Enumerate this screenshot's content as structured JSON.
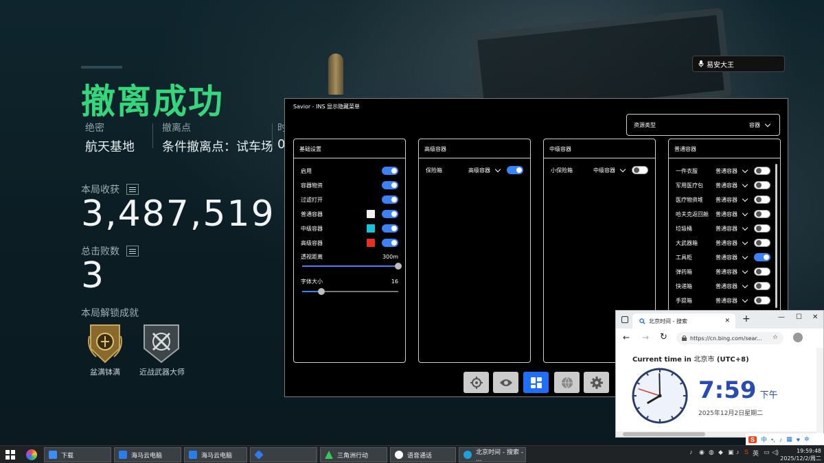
{
  "overlay": {
    "title": "撤离成功",
    "info": [
      {
        "label": "绝密",
        "value": "航天基地"
      },
      {
        "label": "撤离点",
        "value": "条件撤离点：试车场"
      },
      {
        "label": "时",
        "value": "0"
      }
    ],
    "stats": [
      {
        "label": "本局收获",
        "value": "3,487,519"
      },
      {
        "label": "总击败数",
        "value": "3"
      }
    ],
    "achievements_label": "本局解锁成就",
    "achievements": [
      {
        "name": "盆满钵满",
        "icon": "gold-laurel-badge-icon"
      },
      {
        "name": "近战武器大师",
        "icon": "melee-weapons-badge-icon"
      }
    ]
  },
  "user": {
    "name": "易安大王",
    "icon": "mic-icon"
  },
  "menu": {
    "title": "Savior - INS 显示隐藏菜单",
    "resource_type": {
      "label": "资源类型",
      "value": "容器"
    },
    "basic": {
      "header": "基础设置",
      "toggles": [
        {
          "label": "启用",
          "on": true
        },
        {
          "label": "容器物资",
          "on": true
        },
        {
          "label": "过滤打开",
          "on": true
        },
        {
          "label": "普通容器",
          "on": true,
          "swatch": "#f0f0f0"
        },
        {
          "label": "中级容器",
          "on": true,
          "swatch": "#19c4d8"
        },
        {
          "label": "高级容器",
          "on": true,
          "swatch": "#e23222"
        }
      ],
      "sliders": [
        {
          "label": "透视距离",
          "value": "300m",
          "fraction": 1.0
        },
        {
          "label": "字体大小",
          "value": "16",
          "fraction": 0.2
        }
      ]
    },
    "advanced": {
      "header": "高级容器",
      "rows": [
        {
          "label": "保险箱",
          "category": "高级容器",
          "on": true
        }
      ]
    },
    "medium": {
      "header": "中级容器",
      "rows": [
        {
          "label": "小保险箱",
          "category": "中级容器",
          "on": false
        }
      ]
    },
    "normal": {
      "header": "普通容器",
      "rows": [
        {
          "label": "一件衣服",
          "category": "普通容器",
          "on": false
        },
        {
          "label": "军用医疗包",
          "category": "普通容器",
          "on": false
        },
        {
          "label": "医疗物资堆",
          "category": "普通容器",
          "on": false
        },
        {
          "label": "哈夫克返回舱",
          "category": "普通容器",
          "on": false
        },
        {
          "label": "垃圾桶",
          "category": "普通容器",
          "on": false
        },
        {
          "label": "大武器箱",
          "category": "普通容器",
          "on": false
        },
        {
          "label": "工具柜",
          "category": "普通容器",
          "on": true
        },
        {
          "label": "弹药箱",
          "category": "普通容器",
          "on": false
        },
        {
          "label": "快递箱",
          "category": "普通容器",
          "on": false
        },
        {
          "label": "手提箱",
          "category": "普通容器",
          "on": false
        }
      ]
    },
    "toolbar": [
      {
        "icon": "crosshair-icon",
        "active": false
      },
      {
        "icon": "eye-icon",
        "active": false
      },
      {
        "icon": "grid-icon",
        "active": true
      },
      {
        "icon": "globe-icon",
        "active": false
      },
      {
        "icon": "gear-icon",
        "active": false
      }
    ]
  },
  "browser": {
    "tab_title": "北京时间 - 搜索",
    "url": "https://cn.bing.com/sear...",
    "heading_prefix": "Current time in",
    "heading_city": "北京市",
    "heading_suffix": "(UTC+8)",
    "time": "7:59",
    "ampm": "下午",
    "date": "2025年12月2日星期二",
    "clock_hands": {
      "hour": 19,
      "minute": 59,
      "second": 48
    }
  },
  "taskbar": {
    "items": [
      {
        "label": "下载",
        "icon": "download-icon",
        "color": "#3d8df5"
      },
      {
        "label": "海马云电脑",
        "icon": "haima-icon",
        "color": "#2b7de9"
      },
      {
        "label": "海马云电脑",
        "icon": "haima-icon",
        "color": "#2b7de9"
      },
      {
        "label": "",
        "icon": "cube-icon",
        "color": "#2b7de9"
      },
      {
        "label": "三角洲行动",
        "icon": "delta-icon",
        "color": "#34c759"
      },
      {
        "label": "语音通话",
        "icon": "qq-icon",
        "color": "#ffffff"
      },
      {
        "label": "北京时间 - 搜索 - ...",
        "icon": "edge-icon",
        "color": "#1fa0d8"
      }
    ],
    "ime": "中",
    "clock_time": "19:59:48",
    "clock_date": "2025/12/2/周二"
  }
}
